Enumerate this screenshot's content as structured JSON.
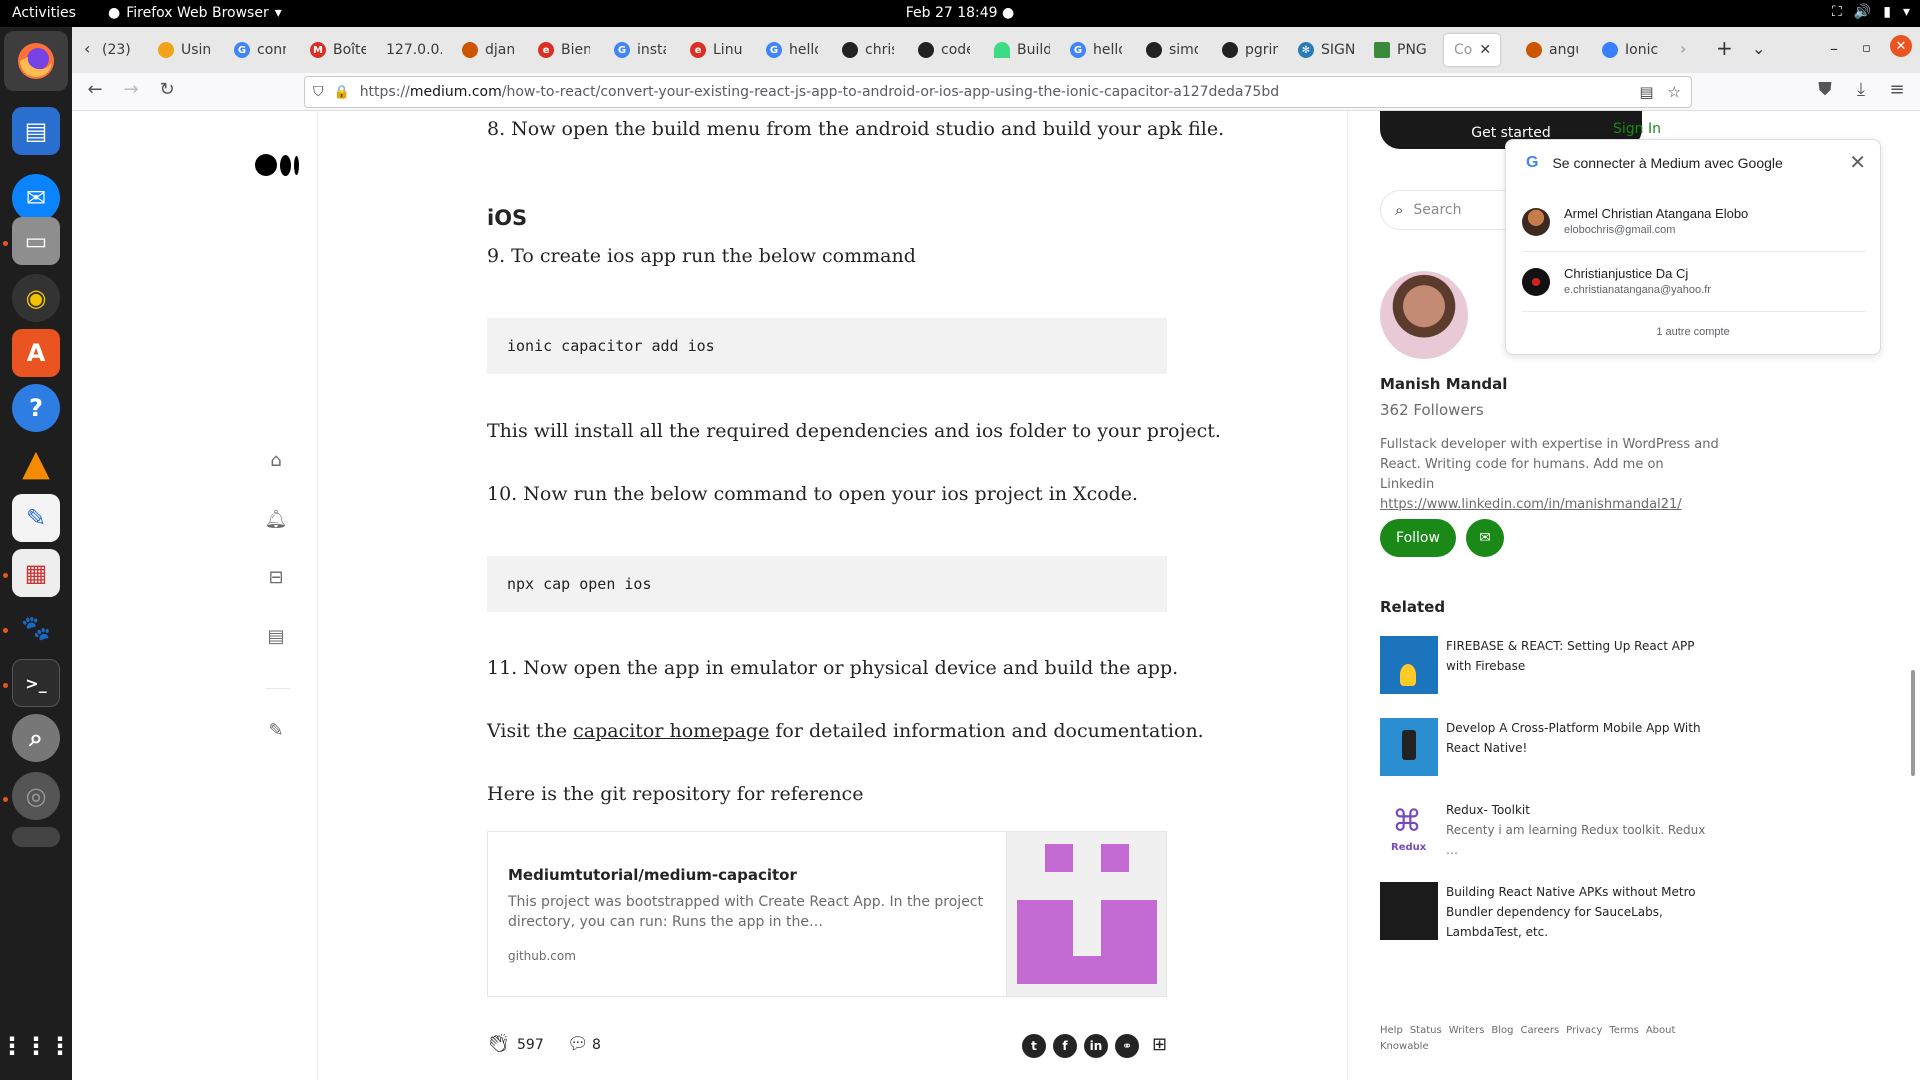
{
  "topbar": {
    "activities": "Activities",
    "app": "Firefox Web Browser",
    "clock": "Feb 27  18:49"
  },
  "dock": {
    "items": [
      "firefox-icon",
      "writer-icon",
      "thunderbird-icon",
      "files-icon",
      "rhythmbox-icon",
      "software-icon",
      "help-icon",
      "vlc-icon",
      "text-editor-icon",
      "document-viewer-icon",
      "gimp-icon",
      "terminal-icon",
      "magnifier-icon",
      "disk-icon",
      "drive-icon",
      "app-grid-icon"
    ]
  },
  "tabs": [
    {
      "label": "(23)",
      "icon": "chevron-left"
    },
    {
      "label": "Using",
      "color": "#f1a21b"
    },
    {
      "label": "conn",
      "color": "#4285f4"
    },
    {
      "label": "Boîte",
      "color": "#d93025"
    },
    {
      "label": "127.0.0.",
      "color": ""
    },
    {
      "label": "djang",
      "color": "#cc5500"
    },
    {
      "label": "Bienv",
      "color": "#d93025"
    },
    {
      "label": "insta",
      "color": "#4285f4"
    },
    {
      "label": "Linux",
      "color": "#d93025"
    },
    {
      "label": "hello",
      "color": "#4285f4"
    },
    {
      "label": "chris",
      "color": "#222222"
    },
    {
      "label": "code",
      "color": "#222222"
    },
    {
      "label": "Build",
      "color": "#3ddc84"
    },
    {
      "label": "hello",
      "color": "#4285f4"
    },
    {
      "label": "simo",
      "color": "#222222"
    },
    {
      "label": "pgrin",
      "color": "#222222"
    },
    {
      "label": "SIGN",
      "color": "#2b7bb9"
    },
    {
      "label": "PNG",
      "color": "#3b8a3b"
    },
    {
      "label": "Co",
      "color": "#ffffff",
      "active": true
    },
    {
      "label": "angu",
      "color": "#cc5500"
    },
    {
      "label": "Ionic",
      "color": "#3880ff"
    }
  ],
  "url": {
    "prefix": "https://",
    "domain": "medium.com",
    "path": "/how-to-react/convert-your-existing-react-js-app-to-android-or-ios-app-using-the-ionic-capacitor-a127deda75bd"
  },
  "article": {
    "step8": "8. Now open the build menu from the android studio and build your apk file.",
    "ios_heading": "iOS",
    "step9": "9. To create ios app run the below command",
    "code1": "ionic capacitor add ios",
    "install_text": "This will install all the required dependencies and ios folder to your project.",
    "step10": "10. Now run the below command to open your ios project in Xcode.",
    "code2": "npx cap open ios",
    "step11": "11. Now open the app in emulator or physical device and build the app.",
    "visit_pre": "Visit the ",
    "visit_link": "capacitor homepage",
    "visit_post": " for detailed information and documentation.",
    "git_text": "Here is the git repository for reference",
    "repo": {
      "title": "Mediumtutorial/medium-capacitor",
      "description": "This project was bootstrapped with Create React App. In the project directory, you can run: Runs the app in the…",
      "domain": "github.com"
    },
    "claps": "597",
    "responses": "8"
  },
  "sidebar": {
    "get_started": "Get started",
    "sign_in": "Sign In",
    "search_placeholder": "Search",
    "author": "Manish Mandal",
    "followers": "362 Followers",
    "bio": "Fullstack developer with expertise in WordPress and React. Writing code for humans. Add me on Linkedin",
    "bio_link": "https://www.linkedin.com/in/manishmandal21/",
    "follow": "Follow",
    "related_heading": "Related",
    "related": [
      {
        "title": "FIREBASE & REACT: Setting Up React APP with Firebase",
        "sub": ""
      },
      {
        "title": "Develop A Cross-Platform Mobile App With React Native!",
        "sub": ""
      },
      {
        "title": "Redux- Toolkit",
        "sub": "Recenty i am learning Redux toolkit. Redux …"
      },
      {
        "title": "Building React Native APKs without Metro Bundler dependency for SauceLabs, LambdaTest, etc.",
        "sub": ""
      }
    ],
    "footer": [
      "Help",
      "Status",
      "Writers",
      "Blog",
      "Careers",
      "Privacy",
      "Terms",
      "About",
      "Knowable"
    ]
  },
  "google_popup": {
    "title": "Se connecter à Medium avec Google",
    "accounts": [
      {
        "name": "Armel Christian Atangana Elobo",
        "email": "elobochris@gmail.com"
      },
      {
        "name": "Christianjustice Da Cj",
        "email": "e.christianatangana@yahoo.fr"
      }
    ],
    "more": "1 autre compte"
  }
}
